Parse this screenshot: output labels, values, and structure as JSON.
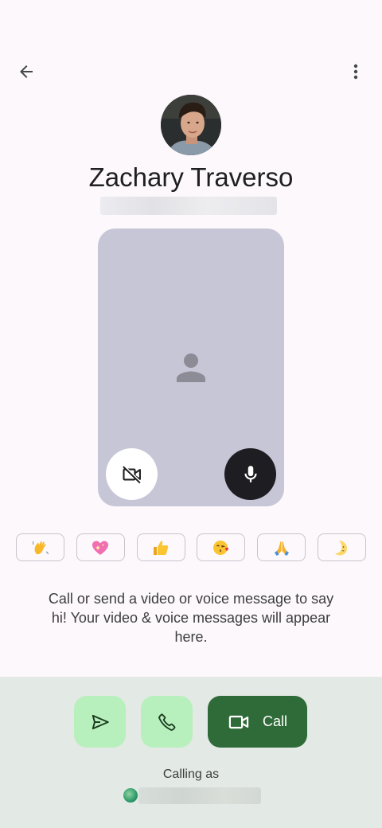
{
  "header": {
    "back_icon": "arrow-back-icon",
    "more_icon": "more-vert-icon"
  },
  "contact": {
    "name": "Zachary Traverso"
  },
  "preview": {
    "placeholder_icon": "person-icon",
    "camera_icon": "videocam-off-icon",
    "mic_icon": "mic-icon"
  },
  "reactions": [
    {
      "emoji": "👋",
      "icon": "waving-hand-icon"
    },
    {
      "emoji": "💖",
      "icon": "sparkling-heart-icon"
    },
    {
      "emoji": "👍",
      "icon": "thumbs-up-icon"
    },
    {
      "emoji": "😘",
      "icon": "face-blowing-kiss-icon"
    },
    {
      "emoji": "🙏",
      "icon": "folded-hands-icon"
    },
    {
      "emoji": "🌜",
      "icon": "moon-face-icon"
    }
  ],
  "hint": "Call or send a video or voice message to say hi! Your video & voice messages will appear here.",
  "actions": {
    "send_icon": "send-icon",
    "voice_call_icon": "phone-icon",
    "video_call_icon": "videocam-icon",
    "video_call_label": "Call"
  },
  "calling_as": {
    "label": "Calling as"
  },
  "colors": {
    "background": "#fcf8fc",
    "preview_card": "#c6c6d6",
    "bottom_panel": "#e3e9e4",
    "light_green_button": "#b8f0bd",
    "dark_green_button": "#2f6b38"
  }
}
